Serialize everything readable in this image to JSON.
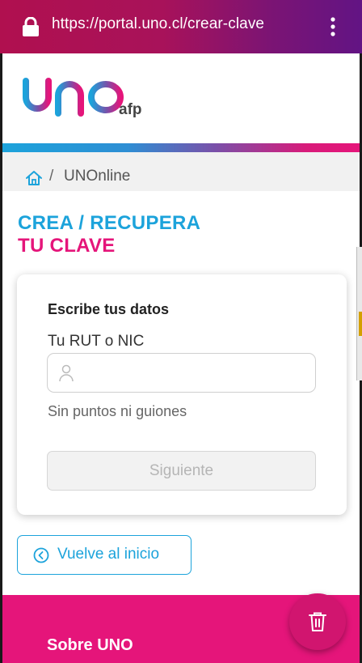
{
  "browser": {
    "url": "https://portal.uno.cl/crear-clave"
  },
  "header": {
    "logo_text": "uno",
    "logo_suffix": "afp"
  },
  "breadcrumb": {
    "separator": "/",
    "label": "UNOnline"
  },
  "page_title": {
    "line1": "CREA / RECUPERA",
    "line2": "TU CLAVE"
  },
  "form": {
    "heading": "Escribe tus datos",
    "rut_label": "Tu RUT o NIC",
    "rut_value": "",
    "rut_placeholder": "",
    "hint": "Sin puntos ni guiones",
    "next_label": "Siguiente"
  },
  "back": {
    "label": "Vuelve al inicio"
  },
  "footer": {
    "title": "Sobre UNO"
  },
  "colors": {
    "cyan": "#1ca3db",
    "magenta": "#e5157a"
  },
  "icons": {
    "lock": "lock-icon",
    "menu": "kebab-menu-icon",
    "home": "home-icon",
    "user": "user-icon",
    "back": "chevron-left-circle-icon",
    "trash": "trash-icon"
  }
}
